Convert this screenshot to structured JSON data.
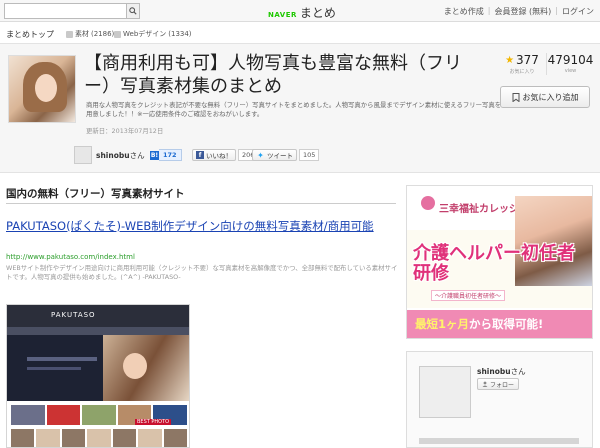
{
  "topbar": {
    "search_placeholder": "",
    "logo_brand": "NAVER",
    "logo_text": "まとめ",
    "links": [
      "まとめ作成",
      "会員登録 (無料)",
      "ログイン"
    ]
  },
  "breadcrumb": {
    "home": "まとめトップ",
    "tags": [
      {
        "label": "素材",
        "count": "(2186)"
      },
      {
        "label": "Webデザイン",
        "count": "(1334)"
      }
    ]
  },
  "header": {
    "title": "【商用利用も可】人物写真も豊富な無料（フリー）写真素材集のまとめ",
    "description": "商用な人物写真をクレジット表記が不要な無料（フリー）写真サイトをまとめました。人物写真から風景までデザイン素材に使えるフリー写真を用意しました！！※一応使用条件のご確認をおねがいします。",
    "updated": "更新日：2013年07月12日",
    "favorites_count": "377",
    "favorites_label": "お気に入り",
    "views_count": "479104",
    "views_label": "view",
    "fav_button_label": "お気に入り追加"
  },
  "author": {
    "name": "shinobu",
    "suffix": "さん"
  },
  "share": {
    "hatena_icon": "B!",
    "hatena_count": "172",
    "facebook_label": "いいね！",
    "facebook_count": "206",
    "twitter_label": "ツイート",
    "twitter_count": "105"
  },
  "content": {
    "section_title": "国内の無料（フリー）写真素材サイト",
    "item_title": "PAKUTASO(ぱくたそ)-WEB制作デザイン向けの無料写真素材/商用可能",
    "item_url": "http://www.pakutaso.com/index.html",
    "item_desc": "WEBサイト制作やデザイン用途向けに商用利用可能（クレジット不要）な写真素材を高解像度でかつ、全部無料で配布している素材サイトです。人物写真の提供も始めました。(^A^) -PAKUTASO-",
    "screenshot_logo": "PAKUTASO",
    "screenshot_best": "BEST PHOTO"
  },
  "ad": {
    "org": "三幸福祉カレッジ",
    "main": "介護ヘルパー初任者研修",
    "sub": "～介護職員初任者研修～",
    "cta_em": "最短1ヶ月",
    "cta_rest": "から取得可能!"
  },
  "profile": {
    "name": "shinobu",
    "suffix": "さん",
    "button_label": "フォロー"
  },
  "colors": {
    "naver_green": "#1ec800",
    "link_blue": "#1a43b3",
    "url_green": "#2c9e2c",
    "ad_pink": "#e0317a",
    "star": "#f2b600"
  }
}
